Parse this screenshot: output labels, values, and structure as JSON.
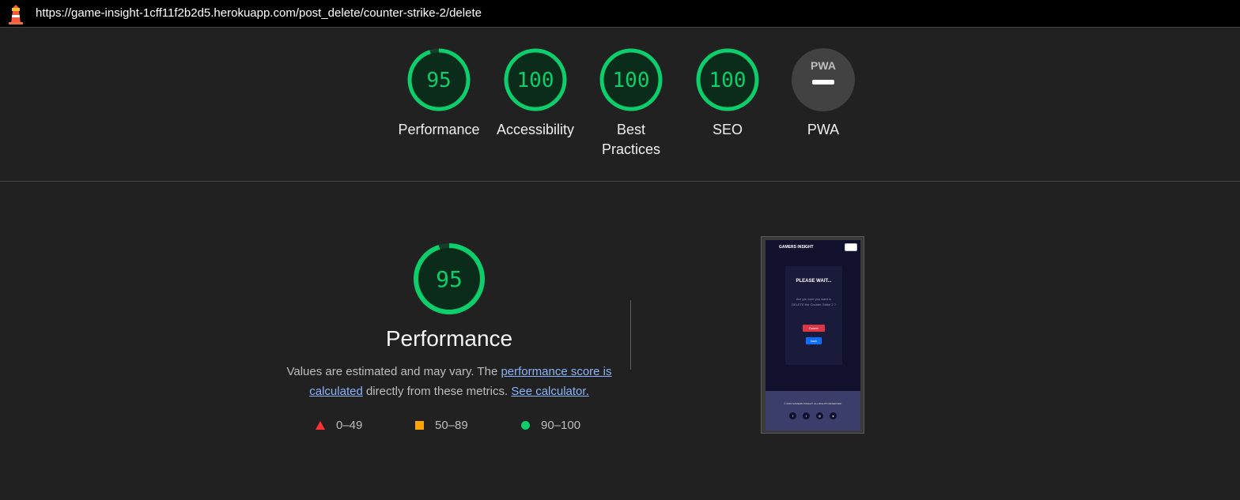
{
  "topbar": {
    "url": "https://game-insight-1cff11f2b2d5.herokuapp.com/post_delete/counter-strike-2/delete",
    "icon": "lighthouse-icon"
  },
  "gauges": [
    {
      "label": "Performance",
      "score": "95",
      "value": 0.95,
      "color": "#0cce6b"
    },
    {
      "label": "Accessibility",
      "score": "100",
      "value": 1.0,
      "color": "#0cce6b"
    },
    {
      "label": "Best Practices",
      "score": "100",
      "value": 1.0,
      "color": "#0cce6b"
    },
    {
      "label": "SEO",
      "score": "100",
      "value": 1.0,
      "color": "#0cce6b"
    },
    {
      "label": "PWA",
      "badge": "PWA",
      "color": "#424242"
    }
  ],
  "performance": {
    "score": "95",
    "value": 0.95,
    "title": "Performance",
    "desc_prefix": "Values are estimated and may vary. The ",
    "link_score": "performance score is calculated",
    "desc_mid": " directly from these metrics. ",
    "link_calc": "See calculator.",
    "legend": [
      {
        "range": "0–49",
        "shape": "triangle",
        "color": "#ff3333"
      },
      {
        "range": "50–89",
        "shape": "square",
        "color": "#ffa400"
      },
      {
        "range": "90–100",
        "shape": "circle",
        "color": "#0cce6b"
      }
    ]
  },
  "screenshot": {
    "brand": "GAMERS INSIGHT",
    "heading": "PLEASE WAIT...",
    "text_line": "Are you sure you want to DELETE the Counter-Strike 2 ?",
    "delete_label": "Delete",
    "back_label": "back",
    "footer_text": "© 2023 GAMERS INSIGHT. ALL RIGHTS RESERVED.",
    "social_icons": [
      "facebook-icon",
      "twitter-icon",
      "instagram-icon",
      "github-icon"
    ]
  },
  "colors": {
    "pass": "#0cce6b",
    "pass_bg": "#0b2b1b",
    "background": "#212121"
  }
}
